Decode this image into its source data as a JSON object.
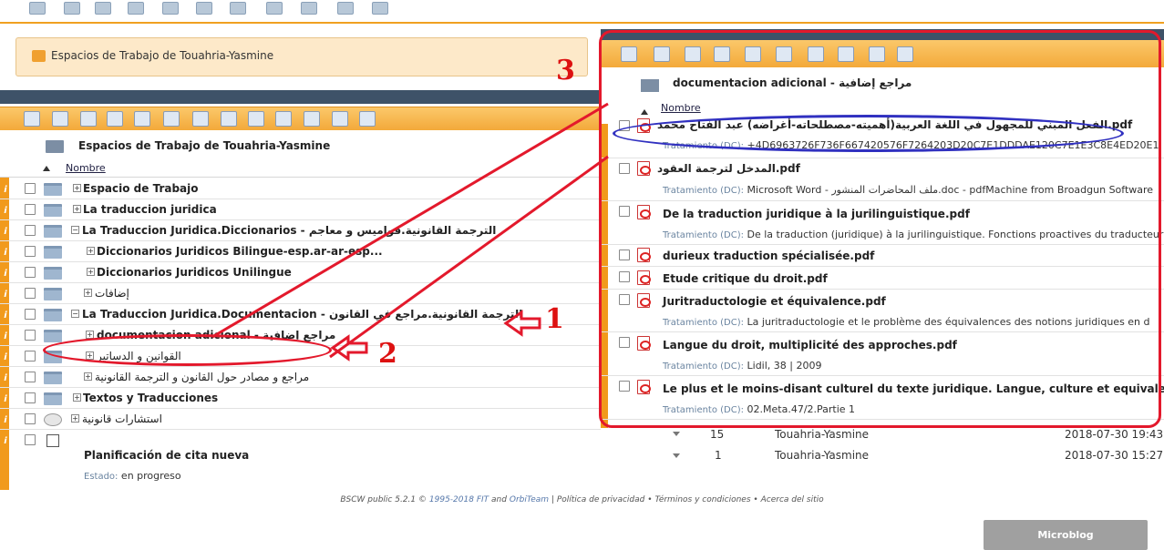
{
  "breadcrumb": {
    "title": "Espacios de Trabajo de Touahria-Yasmine"
  },
  "workspace_title": "Espacios de Trabajo de Touahria-Yasmine",
  "sort_label": "Nombre",
  "tree": [
    {
      "label": "Espacio de Trabajo",
      "bold": true
    },
    {
      "label": "La traduccion juridica",
      "bold": true
    },
    {
      "label": "La Traduccion Juridica.Diccionarios - الترجمة القانونية.قواميس و معاجم",
      "bold": true
    },
    {
      "label": "Diccionarios Juridicos Bilingue-esp.ar-ar-esp...",
      "bold": true
    },
    {
      "label": "Diccionarios Juridicos Unilingue",
      "bold": true
    },
    {
      "label": "إضافات",
      "bold": false
    },
    {
      "label": "La Traduccion Juridica.Documentacion - الترجمة القانونية.مراجع في القانون",
      "bold": true
    },
    {
      "label": "documentacion adicional - مراجع إضافية",
      "bold": true
    },
    {
      "label": "القوانين و الدساتير",
      "bold": false
    },
    {
      "label": "مراجع و مصادر حول القانون و الترجمة القانونية",
      "bold": false
    },
    {
      "label": "Textos y Traducciones",
      "bold": true
    },
    {
      "label": "استشارات قانونية",
      "bold": false
    },
    {
      "label": "Planificación de cita nueva",
      "bold": true
    }
  ],
  "status": {
    "label": "Estado:",
    "value": "en progreso"
  },
  "background_rows": [
    {
      "count": "15",
      "owner": "Touahria-Yasmine",
      "date": "2018-07-30 19:43"
    },
    {
      "count": "1",
      "owner": "Touahria-Yasmine",
      "date": "2018-07-30 15:27"
    }
  ],
  "right_panel": {
    "folder_title": "documentacion adicional - مراجع إضافية",
    "sort_label": "Nombre",
    "files": [
      {
        "name": "الفعل المبني للمجهول في اللغة العربية(أهميته-مصطلحاته-أغراضه) عبد الفتاح محمد.pdf",
        "sub_label": "Tratamiento (DC):",
        "sub": "+4D6963726F736F667420576F7264203D20C7E1DDDAE120C7E1E3C8E4ED20E1"
      },
      {
        "name": "المدخل لترجمة العقود.pdf",
        "sub_label": "Tratamiento (DC):",
        "sub": "Microsoft Word - ملف المحاضرات المنشور.doc - pdfMachine from Broadgun Software"
      },
      {
        "name": "De la traduction juridique à la jurilinguistique.pdf",
        "sub_label": "Tratamiento (DC):",
        "sub": "De la traduction (juridique) à la jurilinguistique. Fonctions proactives du traducteur"
      },
      {
        "name": "durieux traduction spécialisée.pdf",
        "sub_label": "",
        "sub": ""
      },
      {
        "name": "Etude critique du droit.pdf",
        "sub_label": "",
        "sub": ""
      },
      {
        "name": "Juritraductologie et équivalence.pdf",
        "sub_label": "Tratamiento (DC):",
        "sub": "La juritraductologie et le problème des équivalences des notions juridiques en d"
      },
      {
        "name": "Langue du droit, multiplicité des approches.pdf",
        "sub_label": "Tratamiento (DC):",
        "sub": "Lidil, 38 | 2009"
      },
      {
        "name": "Le plus et le moins-disant culturel du texte juridique. Langue, culture et equivalence",
        "sub_label": "Tratamiento (DC):",
        "sub": "02.Meta.47/2.Partie 1"
      }
    ]
  },
  "annotations": {
    "one": "1",
    "two": "2",
    "three": "3"
  },
  "footer": {
    "prefix": "BSCW public 5.2.1 ©",
    "years": "1995-2018",
    "fit": "FIT",
    "and": "and",
    "orbiteam": "OrbiTeam",
    "privacy": "| Política de privacidad",
    "sep1": "•",
    "terms": "Términos y condiciones",
    "sep2": "•",
    "about": "Acerca del sitio"
  },
  "microblog": "Microblog",
  "colors": {
    "orange": "#f19a1c",
    "navy": "#3e5268",
    "red_annotation": "#e3192c",
    "blue_annotation": "#3030c0"
  }
}
